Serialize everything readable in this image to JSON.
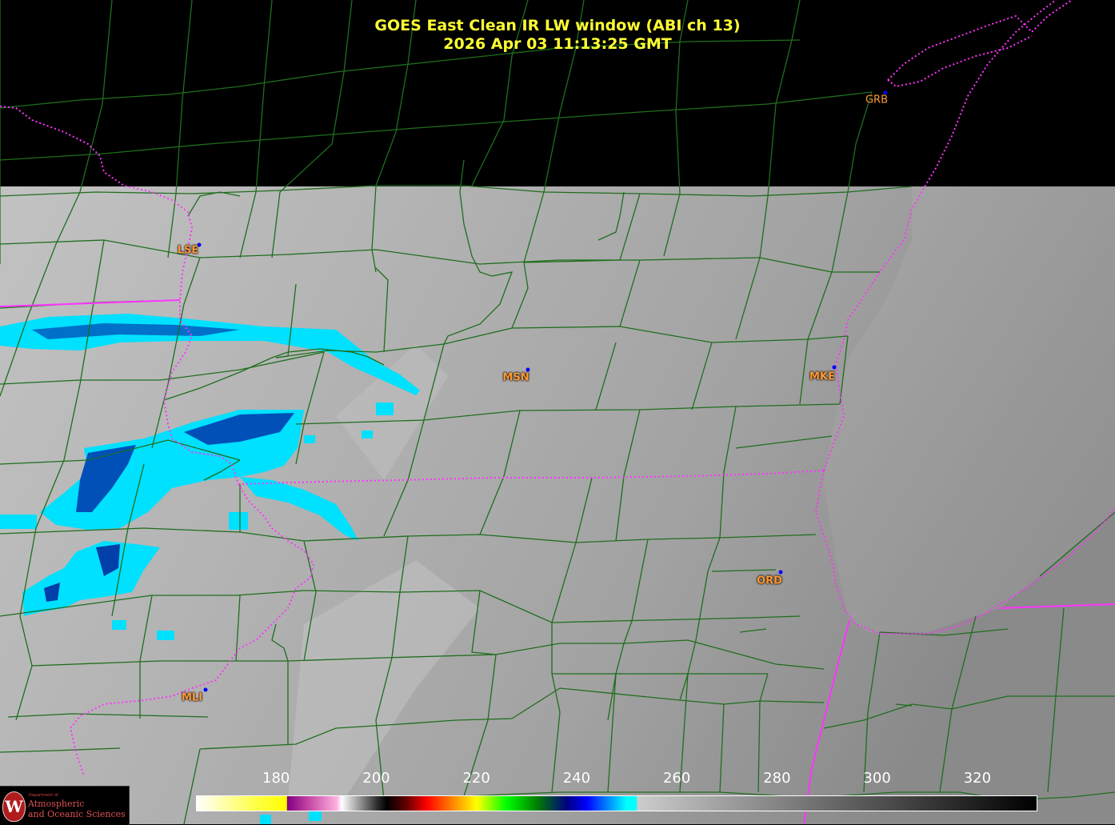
{
  "title": {
    "line1": "GOES East Clean IR LW window (ABI ch 13)",
    "line2": "2026 Apr 03  11:13:25 GMT"
  },
  "cities": [
    {
      "code": "GRB"
    },
    {
      "code": "LSE"
    },
    {
      "code": "MSN"
    },
    {
      "code": "MKE"
    },
    {
      "code": "ORD"
    },
    {
      "code": "MLI"
    }
  ],
  "colorbar": {
    "min": 164,
    "max": 332,
    "ticks": [
      "180",
      "200",
      "220",
      "240",
      "260",
      "280",
      "300",
      "320"
    ],
    "stops": [
      {
        "value": 164,
        "color": "#ffffff"
      },
      {
        "value": 176,
        "color": "#ffff44"
      },
      {
        "value": 182,
        "color": "#ffff00"
      },
      {
        "value": 182.1,
        "color": "#800080"
      },
      {
        "value": 186,
        "color": "#c040a0"
      },
      {
        "value": 192,
        "color": "#ffb0e0"
      },
      {
        "value": 193,
        "color": "#ffffff"
      },
      {
        "value": 200,
        "color": "#303030"
      },
      {
        "value": 202,
        "color": "#000000"
      },
      {
        "value": 206,
        "color": "#660000"
      },
      {
        "value": 210,
        "color": "#ff0000"
      },
      {
        "value": 215,
        "color": "#ff8000"
      },
      {
        "value": 220,
        "color": "#ffff00"
      },
      {
        "value": 226,
        "color": "#00ff00"
      },
      {
        "value": 232,
        "color": "#008000"
      },
      {
        "value": 238,
        "color": "#000080"
      },
      {
        "value": 242,
        "color": "#0000ff"
      },
      {
        "value": 246,
        "color": "#0080ff"
      },
      {
        "value": 250,
        "color": "#00ffff"
      },
      {
        "value": 252,
        "color": "#00ffff"
      },
      {
        "value": 252.1,
        "color": "#cccccc"
      },
      {
        "value": 332,
        "color": "#000000"
      }
    ]
  },
  "logo": {
    "line0": "Department of",
    "line1": "Atmospheric",
    "line2": "and Oceanic Sciences"
  },
  "colors": {
    "title": "#ffff33",
    "county": "#1e6e1e",
    "state": "#ff33ff",
    "city_label": "#ff9933",
    "city_dot": "#0000ff",
    "cloud": "#00e5ff",
    "cloud_deep": "#0050c0"
  }
}
